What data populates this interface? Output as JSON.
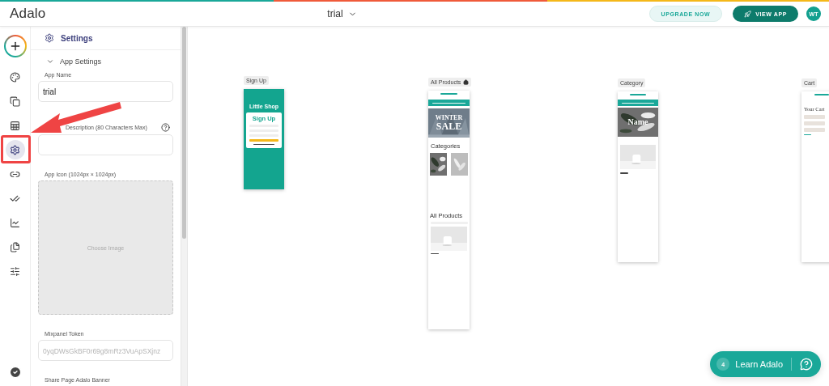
{
  "topbar": {
    "logo": "Adalo",
    "app_name": "trial",
    "buttons": [
      {
        "label": "UPGRADE NOW",
        "kind": "upgrade"
      },
      {
        "label": "VIEW APP",
        "kind": "primary"
      }
    ],
    "avatar": "WT"
  },
  "rail": {
    "items": [
      {
        "kind": "palette",
        "selected": false
      },
      {
        "kind": "screens",
        "selected": false
      },
      {
        "kind": "database",
        "selected": false
      },
      {
        "kind": "settings",
        "selected": true
      },
      {
        "kind": "link",
        "selected": false
      },
      {
        "kind": "checks",
        "selected": false
      },
      {
        "kind": "analytics",
        "selected": false
      },
      {
        "kind": "publish",
        "selected": false
      },
      {
        "kind": "sliders",
        "selected": false
      }
    ]
  },
  "panel": {
    "title": "Settings",
    "section": {
      "title": "App Settings",
      "expanded": true
    },
    "fields": [
      {
        "kind": "input",
        "label": "App Name",
        "value": "trial"
      },
      {
        "kind": "help-input",
        "label": "Description (80 Characters Max)"
      },
      {
        "label": "App Icon (1024px × 1024px)",
        "placeholder": "Choose Image"
      },
      {
        "kind": "input",
        "label": "Mixpanel Token",
        "placeholder": "0yqDWsGkBF0r69g8mRz3VuApSXjnz"
      },
      {
        "kind": "label",
        "label": "Share Page Adalo Banner"
      }
    ]
  },
  "canvas": {
    "screens": [
      {
        "name": "Sign Up",
        "kind": "signup",
        "home": false,
        "brand": "Little Shop",
        "form_title": "Sign Up"
      },
      {
        "name": "All Products",
        "kind": "products",
        "home": true,
        "banner": [
          "WINTER",
          "SALE"
        ],
        "sections": [
          "Categories",
          "All Products"
        ]
      },
      {
        "name": "Category",
        "kind": "category",
        "home": false,
        "banner": "Name"
      },
      {
        "name": "Cart",
        "kind": "cart",
        "home": false,
        "title": "Your Cart"
      }
    ]
  },
  "help": {
    "count": "4",
    "label": "Learn Adalo"
  }
}
